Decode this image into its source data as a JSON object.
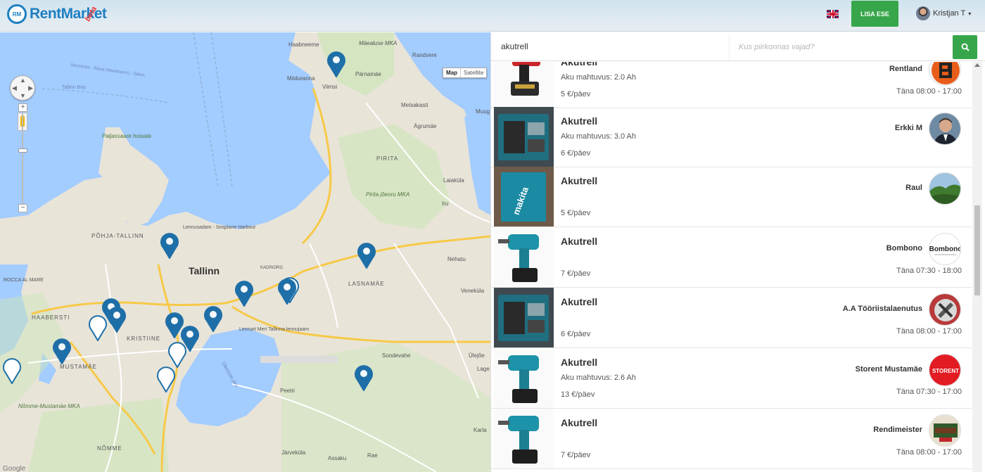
{
  "header": {
    "logo_mark": "RM",
    "logo_text": "RentMarket",
    "logo_badge": "beta",
    "add_button": "LISA ESE",
    "user_name": "Kristjan T",
    "caret": "▾"
  },
  "search": {
    "query": "akutrell",
    "location_placeholder": "Kus piirkonnas vajad?"
  },
  "map": {
    "type_map": "Map",
    "type_satellite": "Satellite",
    "zoom_in": "+",
    "zoom_out": "−",
    "labels": {
      "haabneeme": "Haabneeme",
      "maealuse": "Mäealuse MKA",
      "randvere": "Randvere",
      "parnamae": "Pärnamäe",
      "miiduranna": "Miiduranna",
      "viimsi": "Viimsi",
      "metsakasti": "Metsakasti",
      "muug": "Muug",
      "agrumae": "Ägrumäe",
      "tallinn_bay": "Tallinn Bay",
      "ferry1": "Stockholm - Åland (Mariehamn) - Tallinn",
      "paljassaare": "Paljassaare hoiuala",
      "pirita": "PIRITA",
      "laiakula": "Laiaküla",
      "pirita_joeoru": "Pirita jõeoru MKA",
      "iru": "Iru",
      "lennusadam": "Lennusadam - Seaplane Harbour",
      "pohja_tallinn": "PÕHJA-TALLINN",
      "tallinn": "Tallinn",
      "kadriorg": "KADRIORG",
      "nehatu": "Nehatu",
      "lasnamae": "LASNAMÄE",
      "rocca": "ROCCA AL MARE",
      "venekula": "Veneküla",
      "haabersti": "HAABERSTI",
      "kristiine": "KRISTIINE",
      "lennart": "Lennart Meri Tallinna lennujaam",
      "mustamae": "MUSTAMÄE",
      "soodevahe": "Soodevahe",
      "ulejoe": "Ülejõe",
      "lage": "Lage",
      "ulemiste": "Ülemiste järv",
      "peetri": "Peetri",
      "nomme_mka": "Nõmme-Mustamäe MKA",
      "nomme": "NÕMME",
      "jarvekula": "Järveküla",
      "assaku": "Assaku",
      "rae": "Rae",
      "karla": "Karla",
      "google": "Google"
    }
  },
  "listings": [
    {
      "title": "Akutrell",
      "spec": "Aku mahtuvus: 2.0 Ah",
      "price": "5 €/päev",
      "owner": "Rentland",
      "hours": "Täna 08:00 - 17:00",
      "thumb_icon": "red-drill-icon",
      "avatar_icon": "rentland-logo-icon"
    },
    {
      "title": "Akutrell",
      "spec": "Aku mahtuvus: 3.0 Ah",
      "price": "6 €/päev",
      "owner": "Erkki M",
      "hours": "",
      "thumb_icon": "drill-case-icon",
      "avatar_icon": "man-portrait-icon"
    },
    {
      "title": "Akutrell",
      "spec": "",
      "price": "5 €/päev",
      "owner": "Raul",
      "hours": "",
      "thumb_icon": "drill-box-icon",
      "avatar_icon": "forest-icon"
    },
    {
      "title": "Akutrell",
      "spec": "",
      "price": "7 €/päev",
      "owner": "Bombono",
      "hours": "Täna 07:30 - 18:00",
      "thumb_icon": "teal-drill-icon",
      "avatar_icon": "bombono-logo-icon",
      "avatar_text": "Bombono"
    },
    {
      "title": "Akutrell",
      "spec": "",
      "price": "6 €/päev",
      "owner": "A.A Tööriistalaenutus",
      "hours": "Täna 08:00 - 17:00",
      "thumb_icon": "drill-case-icon",
      "avatar_icon": "tools-logo-icon"
    },
    {
      "title": "Akutrell",
      "spec": "Aku mahtuvus: 2.6 Ah",
      "price": "13 €/päev",
      "owner": "Storent Mustamäe",
      "hours": "Täna 07:30 - 17:00",
      "thumb_icon": "teal-drill-icon",
      "avatar_icon": "storent-logo-icon",
      "avatar_text": "STORENT"
    },
    {
      "title": "Akutrell",
      "spec": "",
      "price": "7 €/päev",
      "owner": "Rendimeister",
      "hours": "Täna 08:00 - 17:00",
      "thumb_icon": "teal-drill-icon",
      "avatar_icon": "rendimeister-logo-icon"
    }
  ],
  "colors": {
    "brand_blue": "#1e7fc1",
    "accent_green": "#37a64a",
    "water": "#a3ccff",
    "land": "#e8e4d8",
    "marker": "#1e6fa8"
  }
}
